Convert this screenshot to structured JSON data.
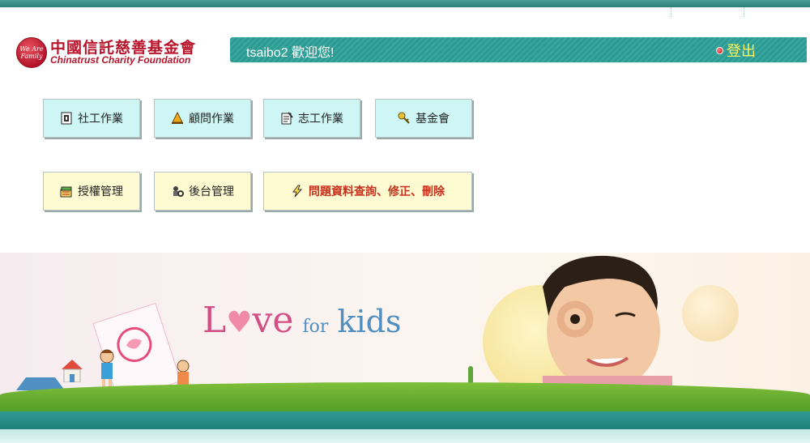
{
  "header": {
    "logo_text_cn": "中國信託慈善基金會",
    "logo_text_en": "Chinatrust Charity Foundation",
    "logo_badge_text": "We Are Family",
    "welcome": "tsaibo2 歡迎您!",
    "logout_label": "登出"
  },
  "menu": {
    "row1": [
      {
        "label": "社工作業",
        "icon": "social-work-icon"
      },
      {
        "label": "顧問作業",
        "icon": "consultant-icon"
      },
      {
        "label": "志工作業",
        "icon": "volunteer-icon"
      },
      {
        "label": "基金會",
        "icon": "foundation-key-icon"
      }
    ],
    "row2": [
      {
        "label": "授權管理",
        "icon": "authorization-icon"
      },
      {
        "label": "後台管理",
        "icon": "backend-icon"
      },
      {
        "label": "問題資料查詢、修正、刪除",
        "icon": "lightning-icon"
      }
    ]
  },
  "banner": {
    "love_l": "L",
    "love_heart": "♥",
    "love_ve": "ve",
    "love_for": "for",
    "love_kids": "kids"
  },
  "colors": {
    "teal": "#2e9b93",
    "cyan_button": "#cdf6f4",
    "yellow_button": "#fefbd2",
    "brand_red": "#b8142b",
    "logout_yellow": "#fff35a"
  }
}
